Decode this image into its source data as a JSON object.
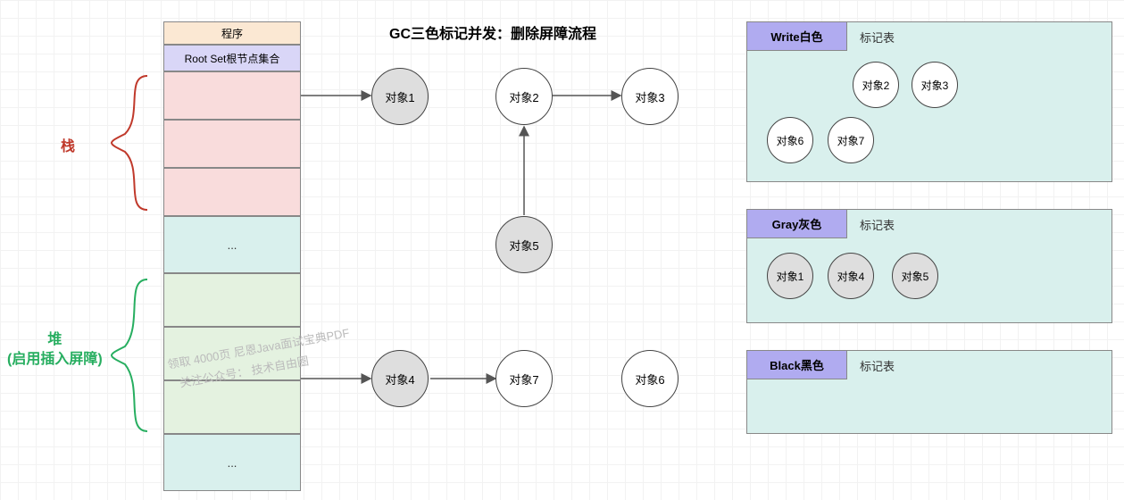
{
  "title": "GC三色标记并发：删除屏障流程",
  "stack_label": "栈",
  "heap_label": "堆\n(启用插入屏障)",
  "column": {
    "program": "程序",
    "rootset": "Root Set根节点集合",
    "dots1": "...",
    "dots2": "..."
  },
  "nodes": {
    "n1": "对象1",
    "n2": "对象2",
    "n3": "对象3",
    "n4": "对象4",
    "n5": "对象5",
    "n6": "对象6",
    "n7": "对象7"
  },
  "tables": {
    "white": {
      "title": "Write白色",
      "sub": "标记表",
      "items": [
        "对象2",
        "对象3",
        "对象6",
        "对象7"
      ]
    },
    "gray": {
      "title": "Gray灰色",
      "sub": "标记表",
      "items": [
        "对象1",
        "对象4",
        "对象5"
      ]
    },
    "black": {
      "title": "Black黑色",
      "sub": "标记表",
      "items": []
    }
  },
  "watermark": {
    "line1": "领取 4000页 尼恩Java面试宝典PDF",
    "line2": "关注公众号： 技术自由圈"
  }
}
